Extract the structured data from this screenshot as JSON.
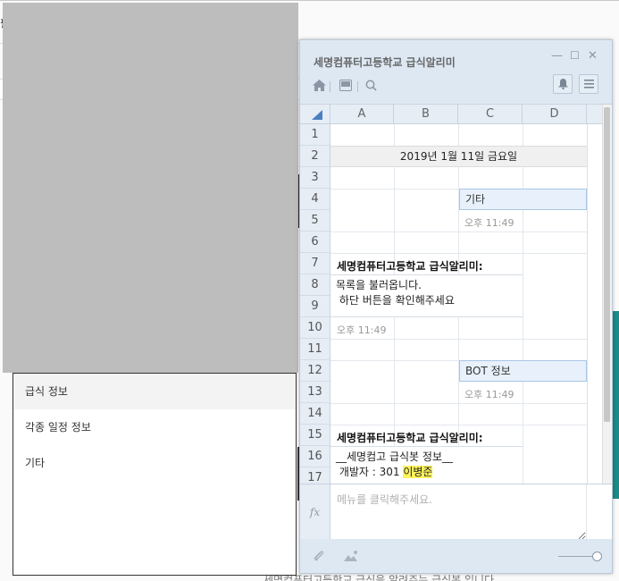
{
  "chat_window": {
    "title": "세명컴퓨터고등학교 급식알리미"
  },
  "sheet": {
    "columns": [
      "A",
      "B",
      "C",
      "D"
    ],
    "rows": [
      "1",
      "2",
      "3",
      "4",
      "5",
      "6",
      "7",
      "8",
      "9",
      "10",
      "11",
      "12",
      "13",
      "14",
      "15",
      "16",
      "17"
    ],
    "date_header": "2019년 1월 11일 금요일",
    "messages": {
      "user1_text": "기타",
      "user1_time": "오후 11:49",
      "bot1_name": "세명컴퓨터고등학교 급식알리미:",
      "bot1_line1": "목록을 불러옵니다.",
      "bot1_line2": " 하단 버튼을 확인해주세요",
      "bot1_time": "오후 11:49",
      "user2_text": "BOT 정보",
      "user2_time": "오후 11:49",
      "bot2_name": "세명컴퓨터고등학교 급식알리미:",
      "bot2_line1": "__세명컴고 급식봇 정보__",
      "bot2_line2_prefix": " 개발자 : 301 ",
      "bot2_line2_highlight": "이병준"
    }
  },
  "input": {
    "placeholder": "메뉴를 클릭해주세요."
  },
  "menu_popup": {
    "items": [
      "급식 정보",
      "각종 일정 정보",
      "기타"
    ]
  },
  "background": {
    "bottom_text": "세명컴퓨터고등학교 급식을 알려주는 급식봇 입니다.",
    "tiny_text": "필"
  },
  "colors": {
    "accent": "#4a7fc0",
    "window_bg": "#dde8f3",
    "highlight": "#fff45c"
  }
}
